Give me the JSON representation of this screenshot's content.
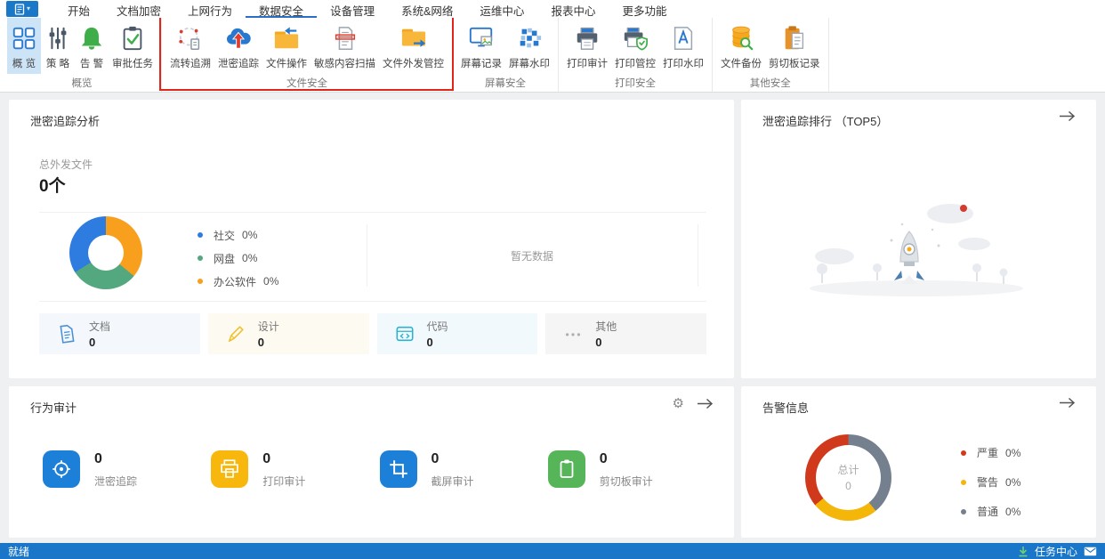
{
  "menu": {
    "app_caret": "▾",
    "tabs": [
      {
        "label": "开始"
      },
      {
        "label": "文档加密"
      },
      {
        "label": "上网行为"
      },
      {
        "label": "数据安全",
        "active": true
      },
      {
        "label": "设备管理"
      },
      {
        "label": "系统&网络"
      },
      {
        "label": "运维中心"
      },
      {
        "label": "报表中心"
      },
      {
        "label": "更多功能"
      }
    ]
  },
  "ribbon": {
    "highlight_color": "#e0251b",
    "groups": [
      {
        "label": "概览",
        "items": [
          {
            "label": "概 览",
            "selected": true
          },
          {
            "label": "策 略"
          },
          {
            "label": "告 警"
          },
          {
            "label": "审批任务"
          }
        ]
      },
      {
        "label": "文件安全",
        "highlighted": true,
        "items": [
          {
            "label": "流转追溯"
          },
          {
            "label": "泄密追踪"
          },
          {
            "label": "文件操作"
          },
          {
            "label": "敏感内容扫描"
          },
          {
            "label": "文件外发管控"
          }
        ]
      },
      {
        "label": "屏幕安全",
        "items": [
          {
            "label": "屏幕记录"
          },
          {
            "label": "屏幕水印"
          }
        ]
      },
      {
        "label": "打印安全",
        "items": [
          {
            "label": "打印审计"
          },
          {
            "label": "打印管控"
          },
          {
            "label": "打印水印"
          }
        ]
      },
      {
        "label": "其他安全",
        "items": [
          {
            "label": "文件备份"
          },
          {
            "label": "剪切板记录"
          }
        ]
      }
    ]
  },
  "panels": {
    "leak_analysis": {
      "title": "泄密追踪分析",
      "total_label": "总外发文件",
      "total_value": "0个",
      "legend": [
        {
          "label": "社交",
          "value": "0%",
          "color": "#2e7ce0"
        },
        {
          "label": "网盘",
          "value": "0%",
          "color": "#53a87f"
        },
        {
          "label": "办公软件",
          "value": "0%",
          "color": "#f8a01e"
        }
      ],
      "no_data": "暂无数据",
      "categories": [
        {
          "label": "文档",
          "value": "0",
          "bg": "#f4f8fd"
        },
        {
          "label": "设计",
          "value": "0",
          "bg": "#fdfaf1"
        },
        {
          "label": "代码",
          "value": "0",
          "bg": "#f2f9fc"
        },
        {
          "label": "其他",
          "value": "0",
          "bg": "#f5f5f6"
        }
      ]
    },
    "leak_ranking": {
      "title": "泄密追踪排行 （TOP5）"
    },
    "behavior_audit": {
      "title": "行为审计",
      "items": [
        {
          "value": "0",
          "label": "泄密追踪",
          "color": "#1c7fd8"
        },
        {
          "value": "0",
          "label": "打印审计",
          "color": "#f8b70d"
        },
        {
          "value": "0",
          "label": "截屏审计",
          "color": "#1c7fd8"
        },
        {
          "value": "0",
          "label": "剪切板审计",
          "color": "#55b558"
        }
      ]
    },
    "alerts": {
      "title": "告警信息",
      "center_label": "总计",
      "center_value": "0",
      "legend": [
        {
          "label": "严重",
          "value": "0%",
          "color": "#d0391c"
        },
        {
          "label": "警告",
          "value": "0%",
          "color": "#f5b60a"
        },
        {
          "label": "普通",
          "value": "0%",
          "color": "#75808f"
        }
      ]
    }
  },
  "status_bar": {
    "ready": "就绪",
    "task_center": "任务中心"
  },
  "chart_data": [
    {
      "type": "pie",
      "variant": "donut",
      "title": "泄密追踪分析",
      "categories": [
        "社交",
        "网盘",
        "办公软件"
      ],
      "values": [
        0,
        0,
        0
      ],
      "unit": "%",
      "legend_position": "right",
      "segments": [
        {
          "label": "办公软件",
          "color": "#f8a01e",
          "pct": 36
        },
        {
          "label": "网盘",
          "color": "#53a87f",
          "pct": 30
        },
        {
          "label": "社交",
          "color": "#2e7ce0",
          "pct": 34
        }
      ]
    },
    {
      "type": "pie",
      "variant": "donut",
      "title": "告警信息",
      "categories": [
        "严重",
        "警告",
        "普通"
      ],
      "values": [
        0,
        0,
        0
      ],
      "unit": "%",
      "center": {
        "label": "总计",
        "value": "0"
      },
      "legend_position": "right",
      "segments": [
        {
          "label": "普通",
          "color": "#75808f",
          "pct": 39
        },
        {
          "label": "警告",
          "color": "#f5b60a",
          "pct": 25
        },
        {
          "label": "严重",
          "color": "#d0391c",
          "pct": 36
        }
      ]
    }
  ]
}
